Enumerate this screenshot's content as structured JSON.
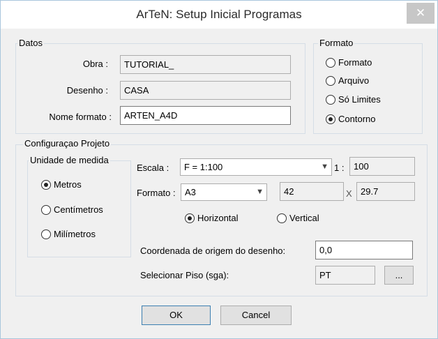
{
  "window": {
    "title": "ArTeN: Setup Inicial Programas",
    "close_glyph": "✕"
  },
  "datos": {
    "legend": "Datos",
    "obra_label": "Obra :",
    "obra_value": "TUTORIAL_",
    "desenho_label": "Desenho :",
    "desenho_value": "CASA",
    "nome_label": "Nome formato :",
    "nome_value": "ARTEN_A4D"
  },
  "formato_group": {
    "legend": "Formato",
    "options": [
      {
        "label": "Formato",
        "checked": false
      },
      {
        "label": "Arquivo",
        "checked": false
      },
      {
        "label": "Só Limites",
        "checked": false
      },
      {
        "label": "Contorno",
        "checked": true
      }
    ]
  },
  "config": {
    "legend": "Configuraçao Projeto",
    "unidade": {
      "legend": "Unidade de medida",
      "options": [
        {
          "label": "Metros",
          "checked": true
        },
        {
          "label": "Centímetros",
          "checked": false
        },
        {
          "label": "Milímetros",
          "checked": false
        }
      ]
    },
    "escala_label": "Escala :",
    "escala_value": "F = 1:100",
    "escala_ratio_label": "1 :",
    "escala_ratio_value": "100",
    "formato_label": "Formato :",
    "formato_value": "A3",
    "width_value": "42",
    "times_glyph": "X",
    "height_value": "29.7",
    "orientation": [
      {
        "label": "Horizontal",
        "checked": true
      },
      {
        "label": "Vertical",
        "checked": false
      }
    ],
    "origem_label": "Coordenada de origem do desenho:",
    "origem_value": "0,0",
    "piso_label": "Selecionar  Piso (sga):",
    "piso_value": "PT",
    "browse_label": "..."
  },
  "buttons": {
    "ok": "OK",
    "cancel": "Cancel"
  },
  "icons": {
    "dropdown": "chevron-down-icon",
    "close": "close-icon"
  }
}
